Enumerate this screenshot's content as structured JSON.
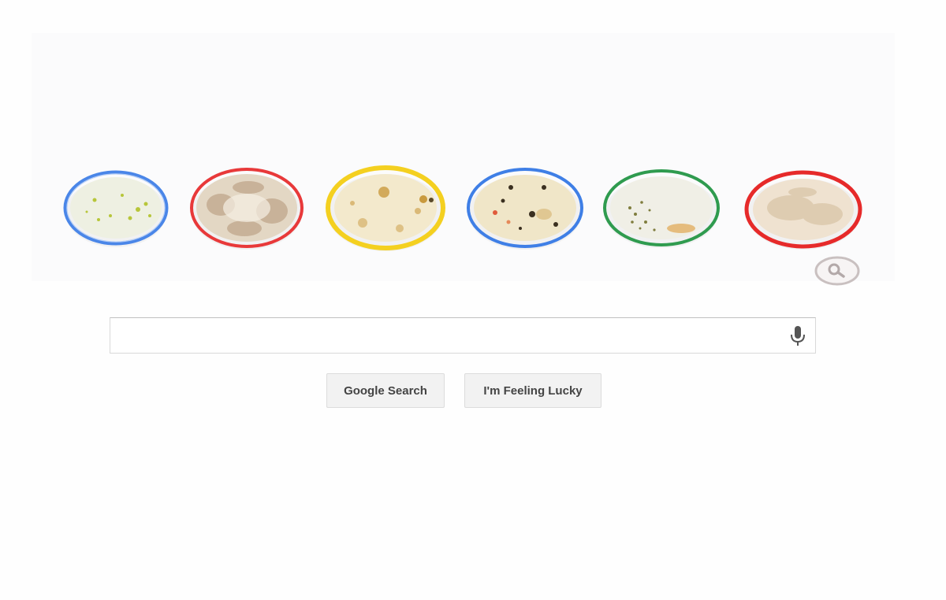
{
  "doodle": {
    "dishes": [
      {
        "rim_color": "#4a86e8",
        "medium_color": "#eef0e2",
        "colony_color": "#b7c63a"
      },
      {
        "rim_color": "#e8393a",
        "medium_color": "#e3d7c4",
        "colony_color": "#b79a7e"
      },
      {
        "rim_color": "#f4d020",
        "medium_color": "#f3e9cc",
        "colony_color": "#c99a3e"
      },
      {
        "rim_color": "#3f7fe6",
        "medium_color": "#f0e6c8",
        "colony_color": "#3b3020"
      },
      {
        "rim_color": "#2f9b4f",
        "medium_color": "#f0efe6",
        "colony_color": "#7f7d3e"
      },
      {
        "rim_color": "#e62a2a",
        "medium_color": "#efe2d0",
        "colony_color": "#cfb894"
      }
    ]
  },
  "search": {
    "value": "",
    "placeholder": ""
  },
  "buttons": {
    "google_search": "Google Search",
    "feeling_lucky": "I'm Feeling Lucky"
  }
}
